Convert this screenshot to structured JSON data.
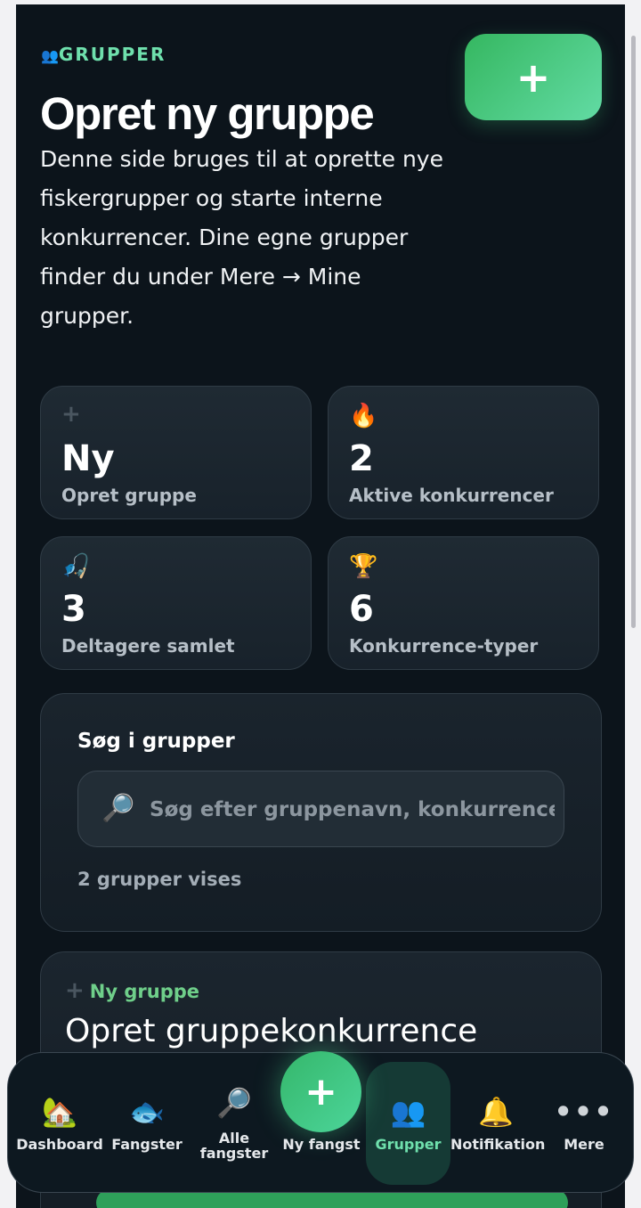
{
  "header": {
    "eyebrow_icon": "👥",
    "eyebrow": "GRUPPER",
    "add_label": "+",
    "title": "Opret ny gruppe",
    "description": "Denne side bruges til at oprette nye fiskergrupper og starte interne konkurrencer. Dine egne grupper finder du under Mere → Mine grupper."
  },
  "stats": [
    {
      "icon": "+",
      "value": "Ny",
      "label": "Opret gruppe"
    },
    {
      "icon": "🔥",
      "value": "2",
      "label": "Aktive konkurrencer"
    },
    {
      "icon": "🎣",
      "value": "3",
      "label": "Deltagere samlet"
    },
    {
      "icon": "🏆",
      "value": "6",
      "label": "Konkurrence-typer"
    }
  ],
  "search": {
    "title": "Søg i grupper",
    "icon": "🔎",
    "placeholder": "Søg efter gruppenavn, konkurrence...",
    "count": "2 grupper vises"
  },
  "group_card": {
    "tag_icon": "+",
    "tag": "Ny gruppe",
    "title": "Opret gruppekonkurrence"
  },
  "nav": {
    "items": [
      {
        "icon": "🏡",
        "label": "Dashboard"
      },
      {
        "icon": "🐟",
        "label": "Fangster"
      },
      {
        "icon": "🔎",
        "label_1": "Alle",
        "label_2": "fangster"
      },
      {
        "icon": "+",
        "label": "Ny fangst"
      },
      {
        "icon": "👥",
        "label": "Grupper"
      },
      {
        "icon": "🔔",
        "label": "Notifikation"
      },
      {
        "icon": "•••",
        "label": "Mere"
      }
    ]
  },
  "colors": {
    "accent": "#6fe0ad",
    "background": "#0c141b",
    "card": "#1b252e",
    "green": "#35b760"
  }
}
